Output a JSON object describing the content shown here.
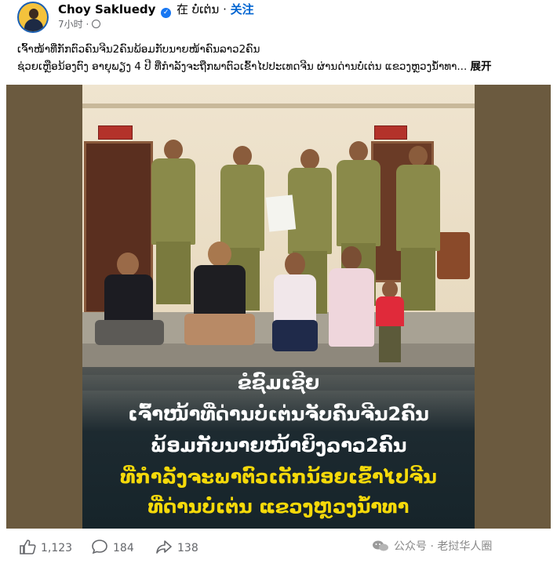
{
  "post": {
    "author": "Choy Sakluedy",
    "location_prefix": "在",
    "location": "ບໍ່ເຕ່ນ",
    "separator": "·",
    "follow_label": "关注",
    "time": "7小时",
    "time_separator": "·",
    "caption_line1": "ເຈົ້າໜ້າທີ່ກັກຕົວຄົນຈີນ2ຄົນພ້ອມກັບນາຍໜ້າຄົນລາວ2ຄົນ",
    "caption_line2": "ຊ່ວຍເຫຼືອນ້ອງຕົງ ອາຍຸພຽງ 4 ປີ ທີ່ກຳລັງຈະຖືກພາຕົວເຂົ້າໄປປະເທດຈີນ ຜ່ານດ່ານບໍ່ເຕ່ນ ແຂວງຫຼວງນ້ຳທາ...",
    "more_label": "展开"
  },
  "image_overlay": {
    "line1": "ຂໍຊົມເຊີຍ",
    "line2": "ເຈົ້າໜ້າທີ່ດ່ານບໍ່ເຕ່ນຈັບຄົນຈີນ2ຄົນ",
    "line3": "ພ້ອມກັບນາຍໜ້າຍິງລາວ2ຄົນ",
    "line4": "ທີ່ກຳລັງຈະພາຕົວເດັກນ້ອຍເຂົ້າໄປຈີນ",
    "line5": "ທີ່ດ່ານບໍ່ເຕ່ນ ແຂວງຫຼວງນ້ຳທາ"
  },
  "stats": {
    "likes": "1,123",
    "comments": "184",
    "shares": "138"
  },
  "watermark": {
    "text": "公众号 · 老挝华人圈"
  },
  "colors": {
    "follow": "#0064d1",
    "overlay_white": "#ffffff",
    "overlay_yellow": "#f5d90a",
    "verified": "#1877f2"
  },
  "icons": [
    "avatar",
    "verified-badge-icon",
    "globe-icon",
    "like-icon",
    "comment-icon",
    "share-icon",
    "wechat-icon"
  ]
}
